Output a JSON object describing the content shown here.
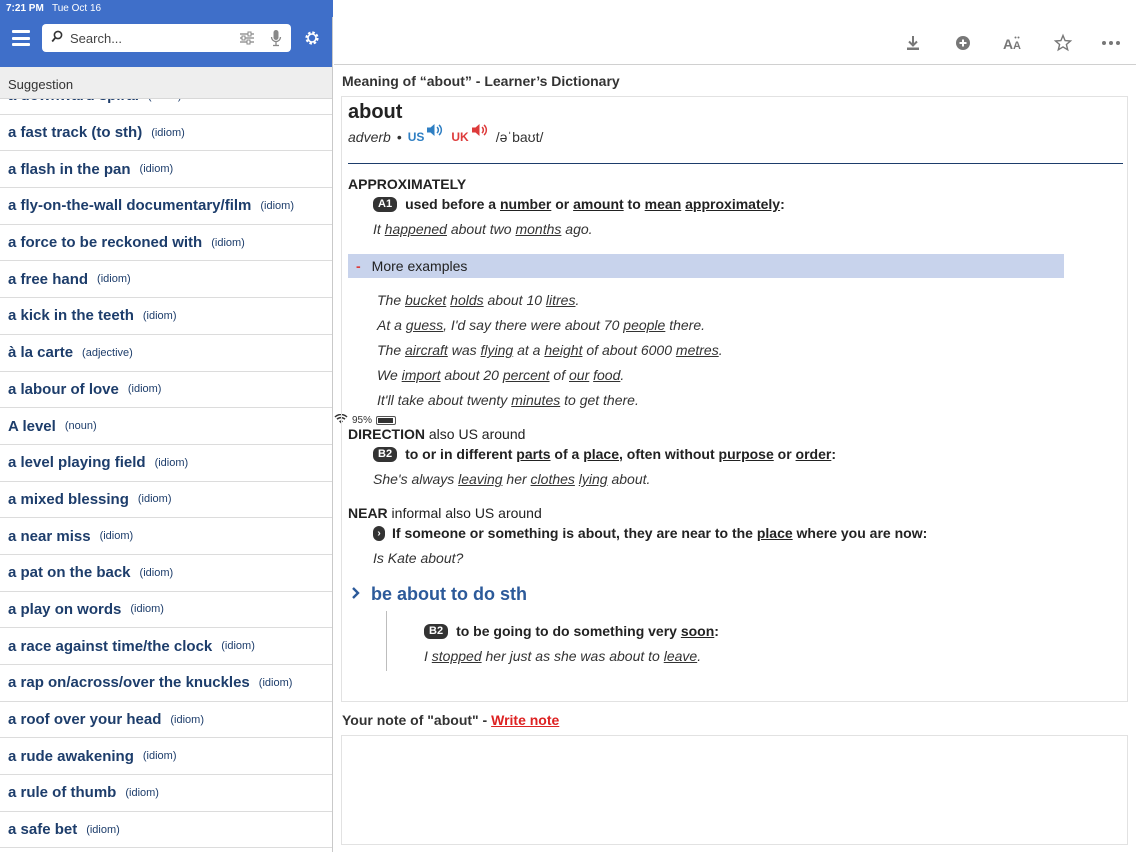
{
  "status_bar": {
    "time": "7:21 PM",
    "date": "Tue Oct 16",
    "battery": "95%"
  },
  "search": {
    "placeholder": "Search..."
  },
  "suggestions": {
    "header": "Suggestion",
    "items": [
      {
        "term": "a downward spiral",
        "pos": "(idiom)"
      },
      {
        "term": "a fast track (to sth)",
        "pos": "(idiom)"
      },
      {
        "term": "a flash in the pan",
        "pos": "(idiom)"
      },
      {
        "term": "a fly-on-the-wall documentary/film",
        "pos": "(idiom)"
      },
      {
        "term": "a force to be reckoned with",
        "pos": "(idiom)"
      },
      {
        "term": "a free hand",
        "pos": "(idiom)"
      },
      {
        "term": "a kick in the teeth",
        "pos": "(idiom)"
      },
      {
        "term": "à la carte",
        "pos": "(adjective)"
      },
      {
        "term": "a labour of love",
        "pos": "(idiom)"
      },
      {
        "term": "A level",
        "pos": "(noun)"
      },
      {
        "term": "a level playing field",
        "pos": "(idiom)"
      },
      {
        "term": "a mixed blessing",
        "pos": "(idiom)"
      },
      {
        "term": "a near miss",
        "pos": "(idiom)"
      },
      {
        "term": "a pat on the back",
        "pos": "(idiom)"
      },
      {
        "term": "a play on words",
        "pos": "(idiom)"
      },
      {
        "term": "a race against time/the clock",
        "pos": "(idiom)"
      },
      {
        "term": "a rap on/across/over the knuckles",
        "pos": "(idiom)"
      },
      {
        "term": "a roof over your head",
        "pos": "(idiom)"
      },
      {
        "term": "a rude awakening",
        "pos": "(idiom)"
      },
      {
        "term": "a rule of thumb",
        "pos": "(idiom)"
      },
      {
        "term": "a safe bet",
        "pos": "(idiom)"
      }
    ]
  },
  "toolbar": {
    "icons": [
      "download-icon",
      "add-circle-icon",
      "text-size-icon",
      "star-icon",
      "more-icon"
    ]
  },
  "entry": {
    "meaning_title": "Meaning of “about” - Learner’s Dictionary",
    "headword": "about",
    "pos": "adverb",
    "bullet": "•",
    "us_label": "US",
    "uk_label": "UK",
    "ipa": "/əˈbaʊt/",
    "sense1": {
      "guide": "APPROXIMATELY",
      "level": "A1",
      "def_parts": [
        "used before a ",
        "number",
        " or ",
        "amount",
        " to ",
        "mean",
        " ",
        "approximately",
        ":"
      ],
      "example_parts": [
        "It ",
        "happened",
        " about two ",
        "months",
        " ago."
      ]
    },
    "more_examples_label": "More examples",
    "more_examples": [
      [
        "The ",
        "bucket",
        " ",
        "holds",
        " about 10 ",
        "litres",
        "."
      ],
      [
        "At a ",
        "guess",
        ", I'd say there were about 70 ",
        "people",
        " there."
      ],
      [
        "The ",
        "aircraft",
        " was ",
        "flying",
        " at a ",
        "height",
        " of about 6000 ",
        "metres",
        "."
      ],
      [
        "We ",
        "import",
        " about 20 ",
        "percent",
        " of ",
        "our",
        " ",
        "food",
        "."
      ],
      [
        "It'll take about twenty ",
        "minutes",
        " to get there."
      ]
    ],
    "sense2": {
      "guide": "DIRECTION",
      "note": " also US around",
      "level": "B2",
      "def_parts": [
        "to or in different ",
        "parts",
        " of a ",
        "place",
        ", often without ",
        "purpose",
        " or ",
        "order",
        ":"
      ],
      "example_parts": [
        "She's always ",
        "leaving",
        " her ",
        "clothes",
        " ",
        "lying",
        " about."
      ]
    },
    "sense3": {
      "guide": "NEAR",
      "note": " informal also US around",
      "level_glyph": "›",
      "def_parts": [
        "If someone or something is about, they are near to the ",
        "place",
        " where you are now:"
      ],
      "example": "Is Kate about?"
    },
    "phrase": {
      "title": "be about to do sth",
      "level": "B2",
      "def_parts": [
        "to be going to do something very ",
        "soon",
        ":"
      ],
      "example_parts": [
        "I ",
        "stopped",
        " her just as she was about to ",
        "leave",
        "."
      ]
    }
  },
  "note": {
    "prefix": "Your note of \"about\" - ",
    "link": "Write note"
  },
  "colors": {
    "header_blue": "#3f6fc9",
    "term_navy": "#1d3d6b",
    "accent_red": "#dd2222",
    "more_bar": "#c8d3ec"
  }
}
